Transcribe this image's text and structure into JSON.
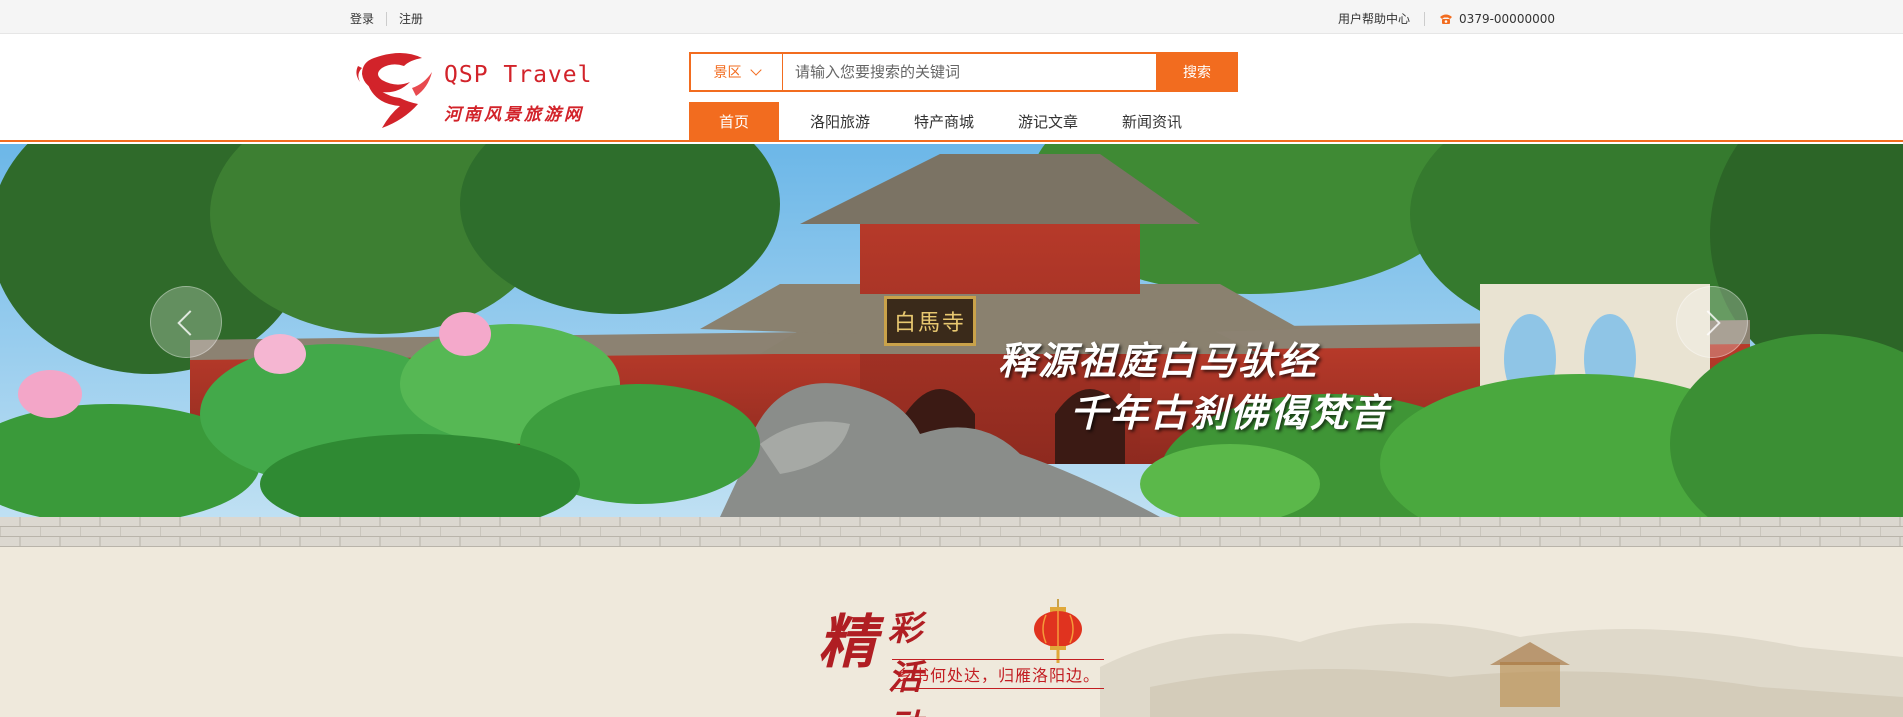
{
  "topbar": {
    "login": "登录",
    "register": "注册",
    "help": "用户帮助中心",
    "phone": "0379-00000000"
  },
  "logo": {
    "name_en": "QSP Travel",
    "name_cn": "河南风景旅游网"
  },
  "search": {
    "category": "景区",
    "placeholder": "请输入您要搜索的关键词",
    "button": "搜索"
  },
  "nav": {
    "items": [
      "首页",
      "洛阳旅游",
      "特产商城",
      "游记文章",
      "新闻资讯"
    ],
    "active_index": 0
  },
  "banner": {
    "plaque": "白馬寺",
    "slogan_line1": "释源祖庭白马驮经",
    "slogan_line2": "千年古刹佛偈梵音"
  },
  "activity": {
    "title_big": "精",
    "title_rest": "彩活动",
    "subtitle": "乡书何处达，归雁洛阳边。"
  },
  "colors": {
    "accent": "#f26c1f",
    "brand_red": "#d2232a"
  }
}
